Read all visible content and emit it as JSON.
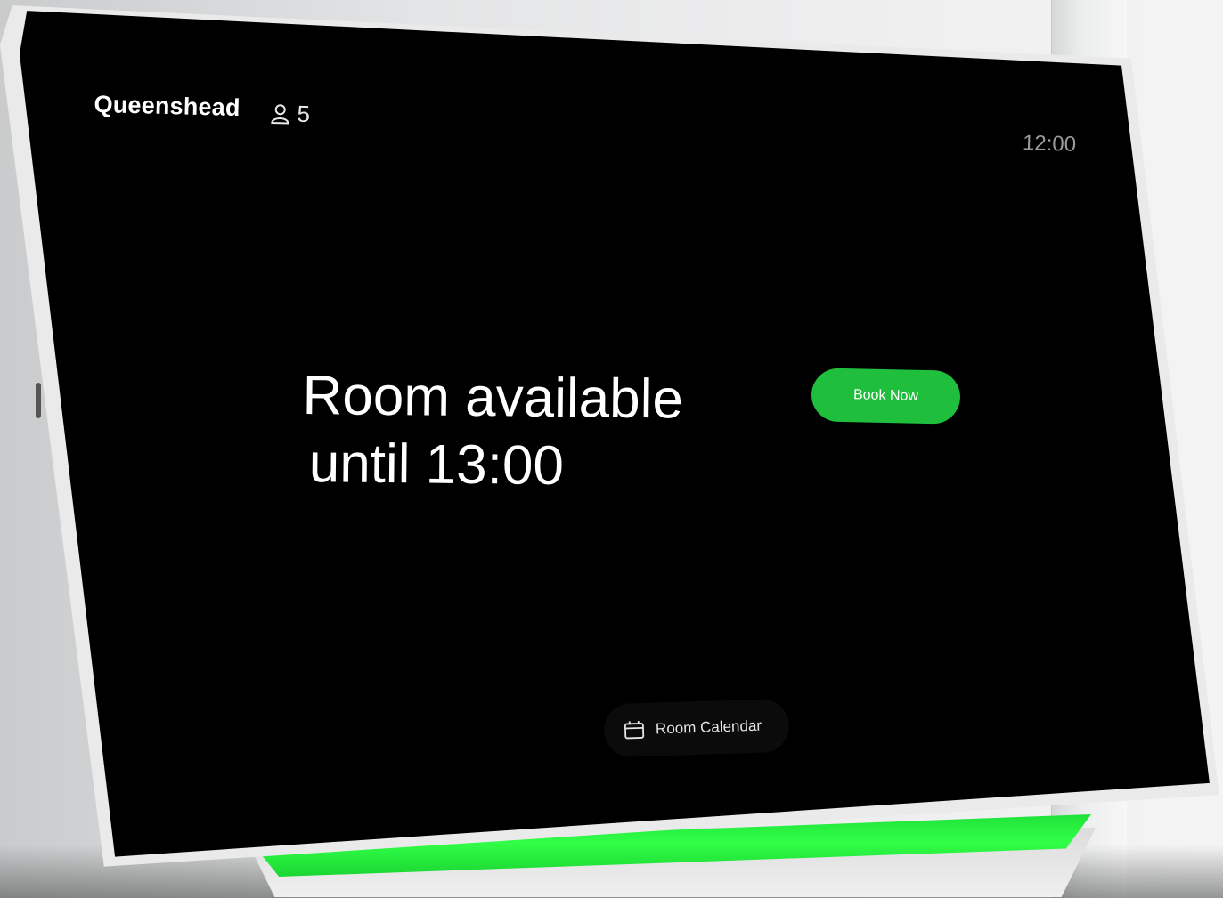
{
  "device": {
    "room_name": "Queenshead",
    "capacity": "5",
    "clock": "12:00",
    "status_line1": "Room available",
    "status_line2": "until 13:00",
    "book_button_label": "Book Now",
    "calendar_button_label": "Room Calendar",
    "icons": {
      "capacity": "person-icon",
      "calendar": "calendar-icon"
    }
  },
  "colors": {
    "screen_background": "#000000",
    "accent_green": "#1fbe3c",
    "led_green": "#31ff47",
    "text_primary": "#ffffff",
    "text_secondary": "#9a9a9a"
  }
}
